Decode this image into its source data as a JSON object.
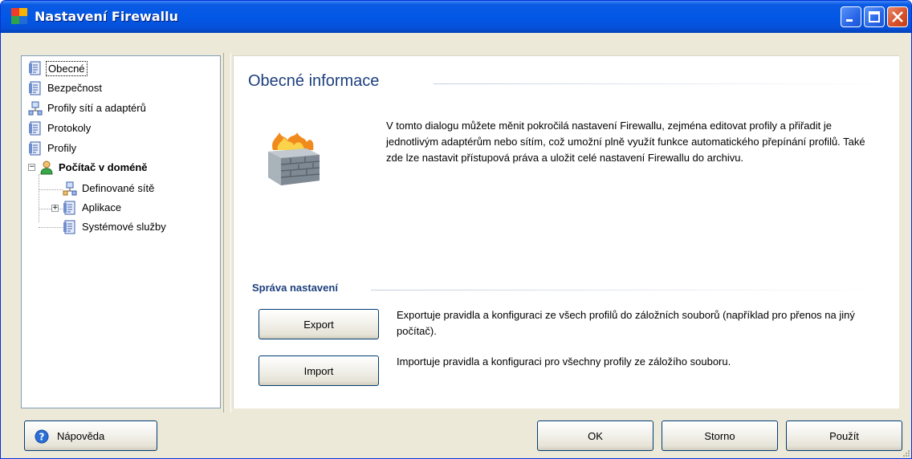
{
  "window": {
    "title": "Nastavení Firewallu",
    "icons": {
      "app": "avg-logo-icon",
      "minimize": "minimize-icon",
      "maximize": "maximize-icon",
      "close": "close-icon"
    }
  },
  "tree": {
    "items": [
      {
        "label": "Obecné",
        "icon": "document-icon",
        "selected": true
      },
      {
        "label": "Bezpečnost",
        "icon": "document-icon"
      },
      {
        "label": "Profily sítí a adaptérů",
        "icon": "network-icon"
      },
      {
        "label": "Protokoly",
        "icon": "document-icon"
      },
      {
        "label": "Profily",
        "icon": "document-icon"
      },
      {
        "label": "Počítač v doméně",
        "icon": "user-icon",
        "bold": true,
        "expanded": true
      },
      {
        "label": "Definované sítě",
        "icon": "network-icon"
      },
      {
        "label": "Aplikace",
        "icon": "document-icon",
        "expanded": false
      },
      {
        "label": "Systémové služby",
        "icon": "document-icon"
      }
    ]
  },
  "content": {
    "heading": "Obecné informace",
    "description": "V tomto dialogu můžete měnit pokročilá nastavení Firewallu, zejména editovat profily a přiřadit je jednotlivým adaptérům nebo sítím, což umožní plně využít funkce automatického přepínání profilů. Také zde lze nastavit přístupová práva a uložit celé nastavení Firewallu do archivu.",
    "illustration": "firewall-wall-icon",
    "section_title": "Správa nastavení",
    "export_label": "Export",
    "export_desc": "Exportuje pravidla a konfiguraci ze všech profilů do záložních souborů (například pro přenos na jiný počítač).",
    "import_label": "Import",
    "import_desc": "Importuje pravidla a konfiguraci pro všechny profily ze záložího souboru."
  },
  "footer": {
    "help_label": "Nápověda",
    "ok_label": "OK",
    "cancel_label": "Storno",
    "apply_label": "Použít"
  },
  "colors": {
    "title_bar": "#0258e6",
    "heading": "#1d3f7d",
    "face": "#ece9d8"
  }
}
